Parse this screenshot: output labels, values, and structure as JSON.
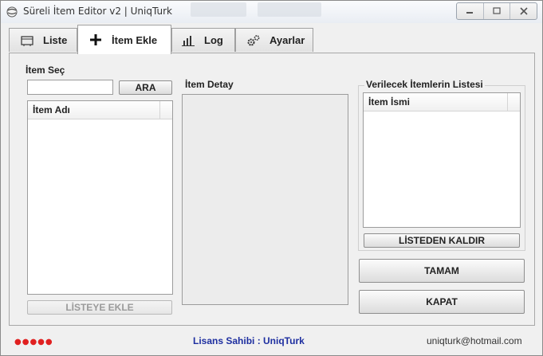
{
  "window": {
    "title": "Süreli İtem Editor v2  |  UniqTurk",
    "app_icon": "globe-icon",
    "controls": [
      "minimize-icon",
      "maximize-icon",
      "close-icon"
    ]
  },
  "tabs": [
    {
      "label": "Liste",
      "icon": "table-icon",
      "active": false
    },
    {
      "label": "İtem Ekle",
      "icon": "plus-icon",
      "active": true
    },
    {
      "label": "Log",
      "icon": "bar-chart-icon",
      "active": false
    },
    {
      "label": "Ayarlar",
      "icon": "gears-icon",
      "active": false
    }
  ],
  "item_select": {
    "group_label": "İtem Seç",
    "search_value": "",
    "search_button": "ARA",
    "column_header": "İtem Adı",
    "add_button": "LİSTEYE EKLE"
  },
  "item_detail": {
    "group_label": "İtem Detay"
  },
  "given_items": {
    "group_label": "Verilecek İtemlerin Listesi",
    "column_header": "İtem İsmi",
    "remove_button": "LİSTEDEN KALDIR"
  },
  "actions": {
    "ok_button": "TAMAM",
    "close_button": "KAPAT"
  },
  "status": {
    "dots": "●●●●●",
    "dots_color": "#e02020",
    "license": "Lisans Sahibi : UniqTurk",
    "license_color": "#1e2fa0",
    "email": "uniqturk@hotmail.com"
  }
}
